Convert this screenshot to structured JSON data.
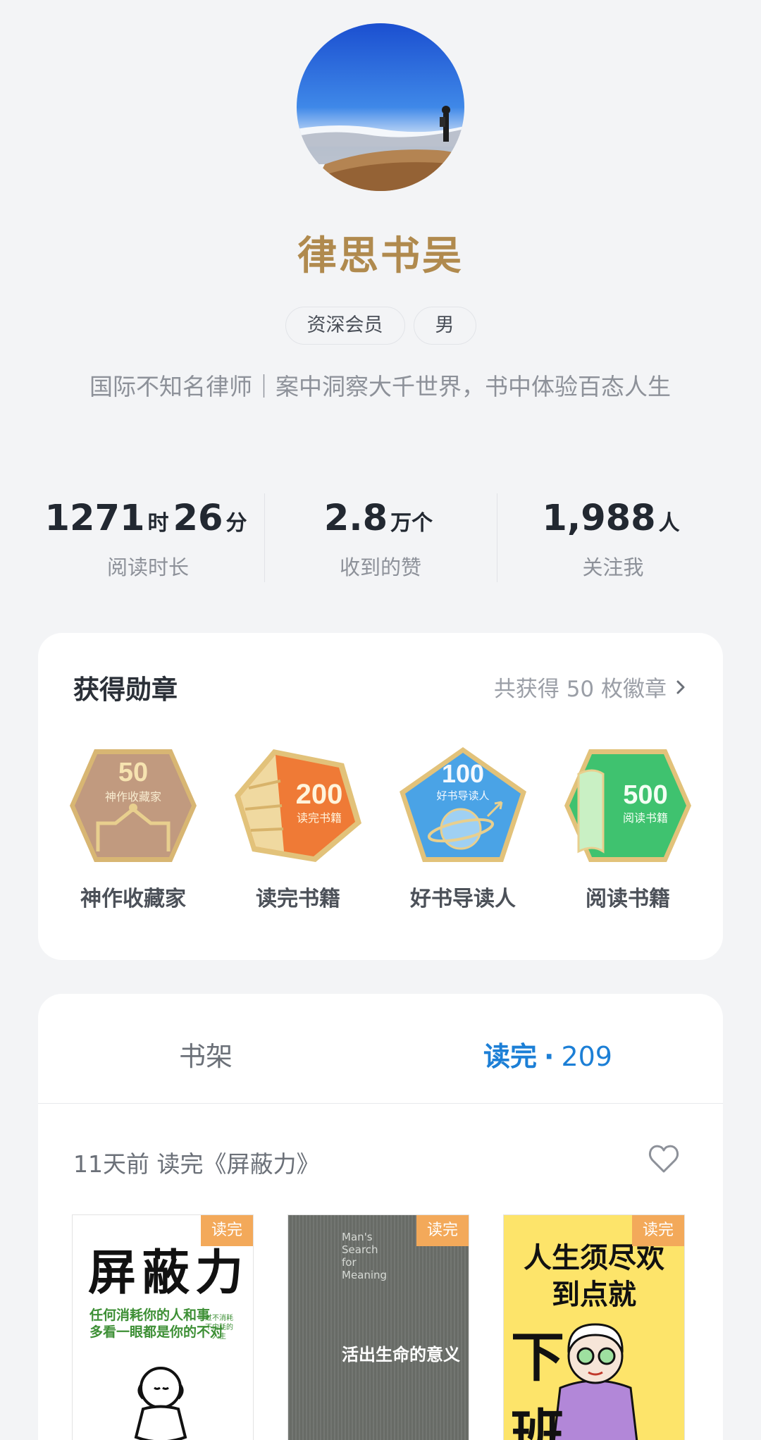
{
  "profile": {
    "name": "律思书吴",
    "tags": [
      "资深会员",
      "男"
    ],
    "bio": "国际不知名律师｜案中洞察大千世界，书中体验百态人生"
  },
  "stats": [
    {
      "value_a": "1271",
      "unit_a": "时",
      "value_b": "26",
      "unit_b": "分",
      "label": "阅读时长"
    },
    {
      "value_a": "2.8",
      "unit_a": "万个",
      "value_b": "",
      "unit_b": "",
      "label": "收到的赞"
    },
    {
      "value_a": "1,988",
      "unit_a": "人",
      "value_b": "",
      "unit_b": "",
      "label": "关注我"
    }
  ],
  "badges": {
    "title": "获得勋章",
    "count_text": "共获得 50 枚徽章",
    "items": [
      {
        "number": "50",
        "inner": "神作收藏家",
        "name": "神作收藏家",
        "color": "#c19a7f"
      },
      {
        "number": "200",
        "inner": "读完书籍",
        "name": "读完书籍",
        "color": "#ef7a36"
      },
      {
        "number": "100",
        "inner": "好书导读人",
        "name": "好书导读人",
        "color": "#4aa3e6"
      },
      {
        "number": "500",
        "inner": "阅读书籍",
        "name": "阅读书籍",
        "color": "#3fc26f"
      }
    ]
  },
  "shelf": {
    "tab_shelf": "书架",
    "tab_read": "读完",
    "tab_read_dot": "·",
    "tab_read_count": "209",
    "activity": "11天前 读完《屏蔽力》",
    "read_tag": "读完",
    "books": [
      {
        "title": "屏蔽力",
        "subtitle_1": "任何消耗你的人和事",
        "subtitle_2": "多看一眼都是你的不对",
        "side_1": "过不消耗",
        "side_2": "不内耗的",
        "side_3": "人生"
      },
      {
        "en_1": "Man's",
        "en_2": "Search",
        "en_3": "for",
        "en_4": "Meaning",
        "title": "活出生命的意义"
      },
      {
        "line_1": "人生须尽欢",
        "line_2": "到点就",
        "line_3": "下班"
      }
    ]
  }
}
